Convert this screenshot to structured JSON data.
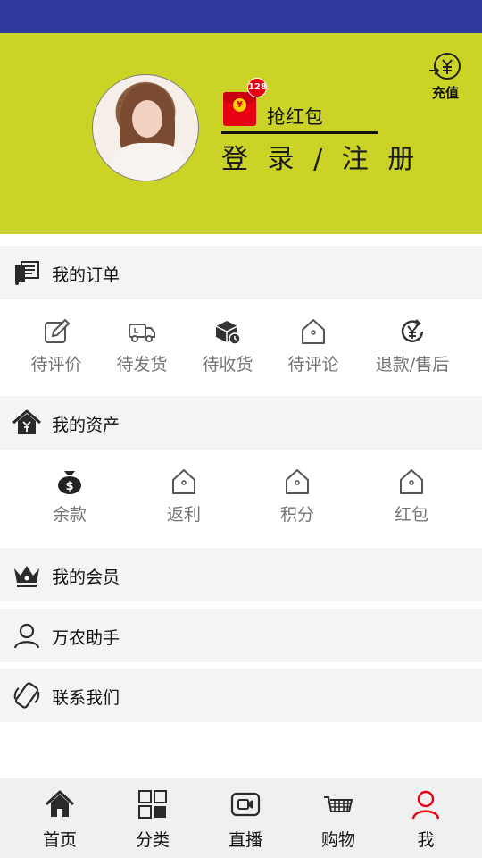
{
  "header": {
    "recharge_label": "充值",
    "red_packet_label": "抢红包",
    "red_packet_badge": "128",
    "login_label": "登 录 / 注 册"
  },
  "orders": {
    "title": "我的订单",
    "items": [
      {
        "label": "待评价",
        "icon": "edit-icon"
      },
      {
        "label": "待发货",
        "icon": "truck-icon"
      },
      {
        "label": "待收货",
        "icon": "package-clock-icon"
      },
      {
        "label": "待评论",
        "icon": "house-icon"
      },
      {
        "label": "退款/售后",
        "icon": "yen-refund-icon"
      }
    ]
  },
  "assets": {
    "title": "我的资产",
    "items": [
      {
        "label": "余款",
        "icon": "money-bag-icon"
      },
      {
        "label": "返利",
        "icon": "house-icon"
      },
      {
        "label": "积分",
        "icon": "house-icon"
      },
      {
        "label": "红包",
        "icon": "house-icon"
      }
    ]
  },
  "menu": [
    {
      "label": "我的会员",
      "icon": "crown-icon"
    },
    {
      "label": "万农助手",
      "icon": "user-icon"
    },
    {
      "label": "联系我们",
      "icon": "phone-icon"
    }
  ],
  "tabs": [
    {
      "label": "首页",
      "icon": "home-icon"
    },
    {
      "label": "分类",
      "icon": "grid-icon"
    },
    {
      "label": "直播",
      "icon": "video-icon"
    },
    {
      "label": "购物",
      "icon": "cart-icon"
    },
    {
      "label": "我",
      "icon": "profile-icon",
      "active": true
    }
  ],
  "colors": {
    "status_bar": "#2f3a9e",
    "header_bg": "#cbd326",
    "accent_red": "#e60012"
  }
}
